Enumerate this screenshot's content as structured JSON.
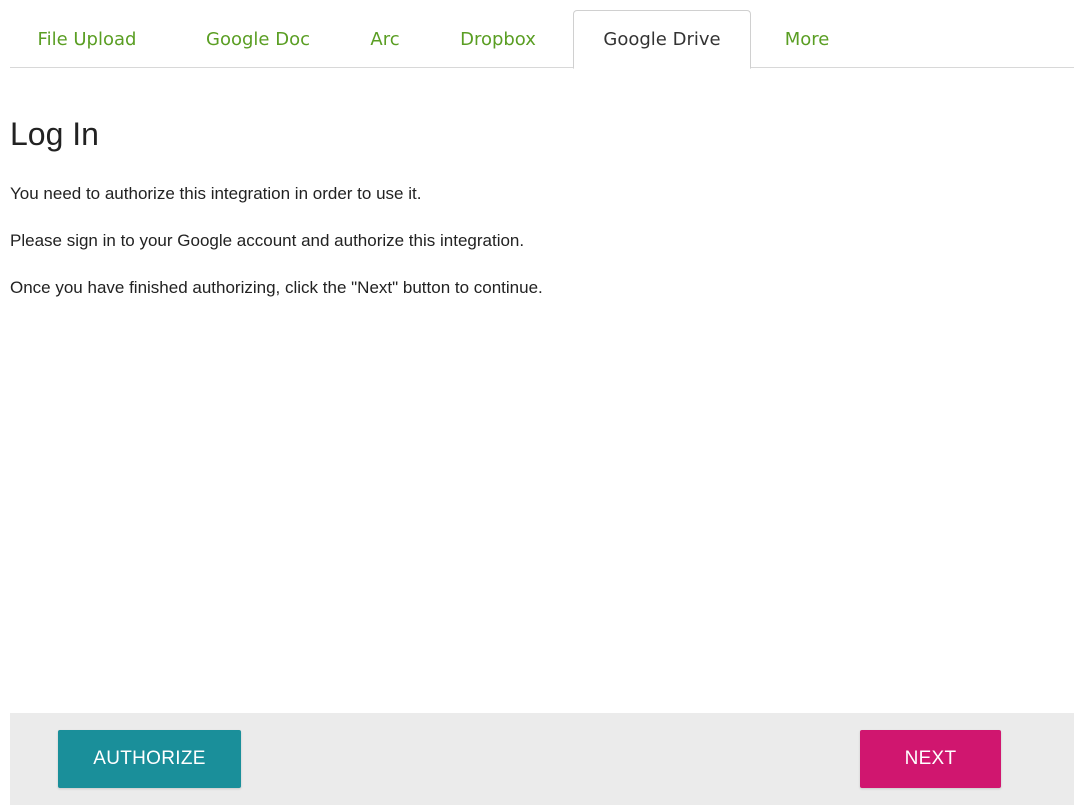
{
  "tabs": [
    {
      "label": "File Upload",
      "active": false
    },
    {
      "label": "Google Doc",
      "active": false
    },
    {
      "label": "Arc",
      "active": false
    },
    {
      "label": "Dropbox",
      "active": false
    },
    {
      "label": "Google Drive",
      "active": true
    },
    {
      "label": "More",
      "active": false
    }
  ],
  "content": {
    "title": "Log In",
    "paragraphs": [
      "You need to authorize this integration in order to use it.",
      "Please sign in to your Google account and authorize this integration.",
      "Once you have finished authorizing, click the \"Next\" button to continue."
    ]
  },
  "footer": {
    "authorize_label": "AUTHORIZE",
    "next_label": "NEXT"
  },
  "colors": {
    "tab_link": "#5a9e23",
    "authorize_button": "#1a8f9a",
    "next_button": "#d0166f",
    "footer_background": "#ebebeb"
  }
}
